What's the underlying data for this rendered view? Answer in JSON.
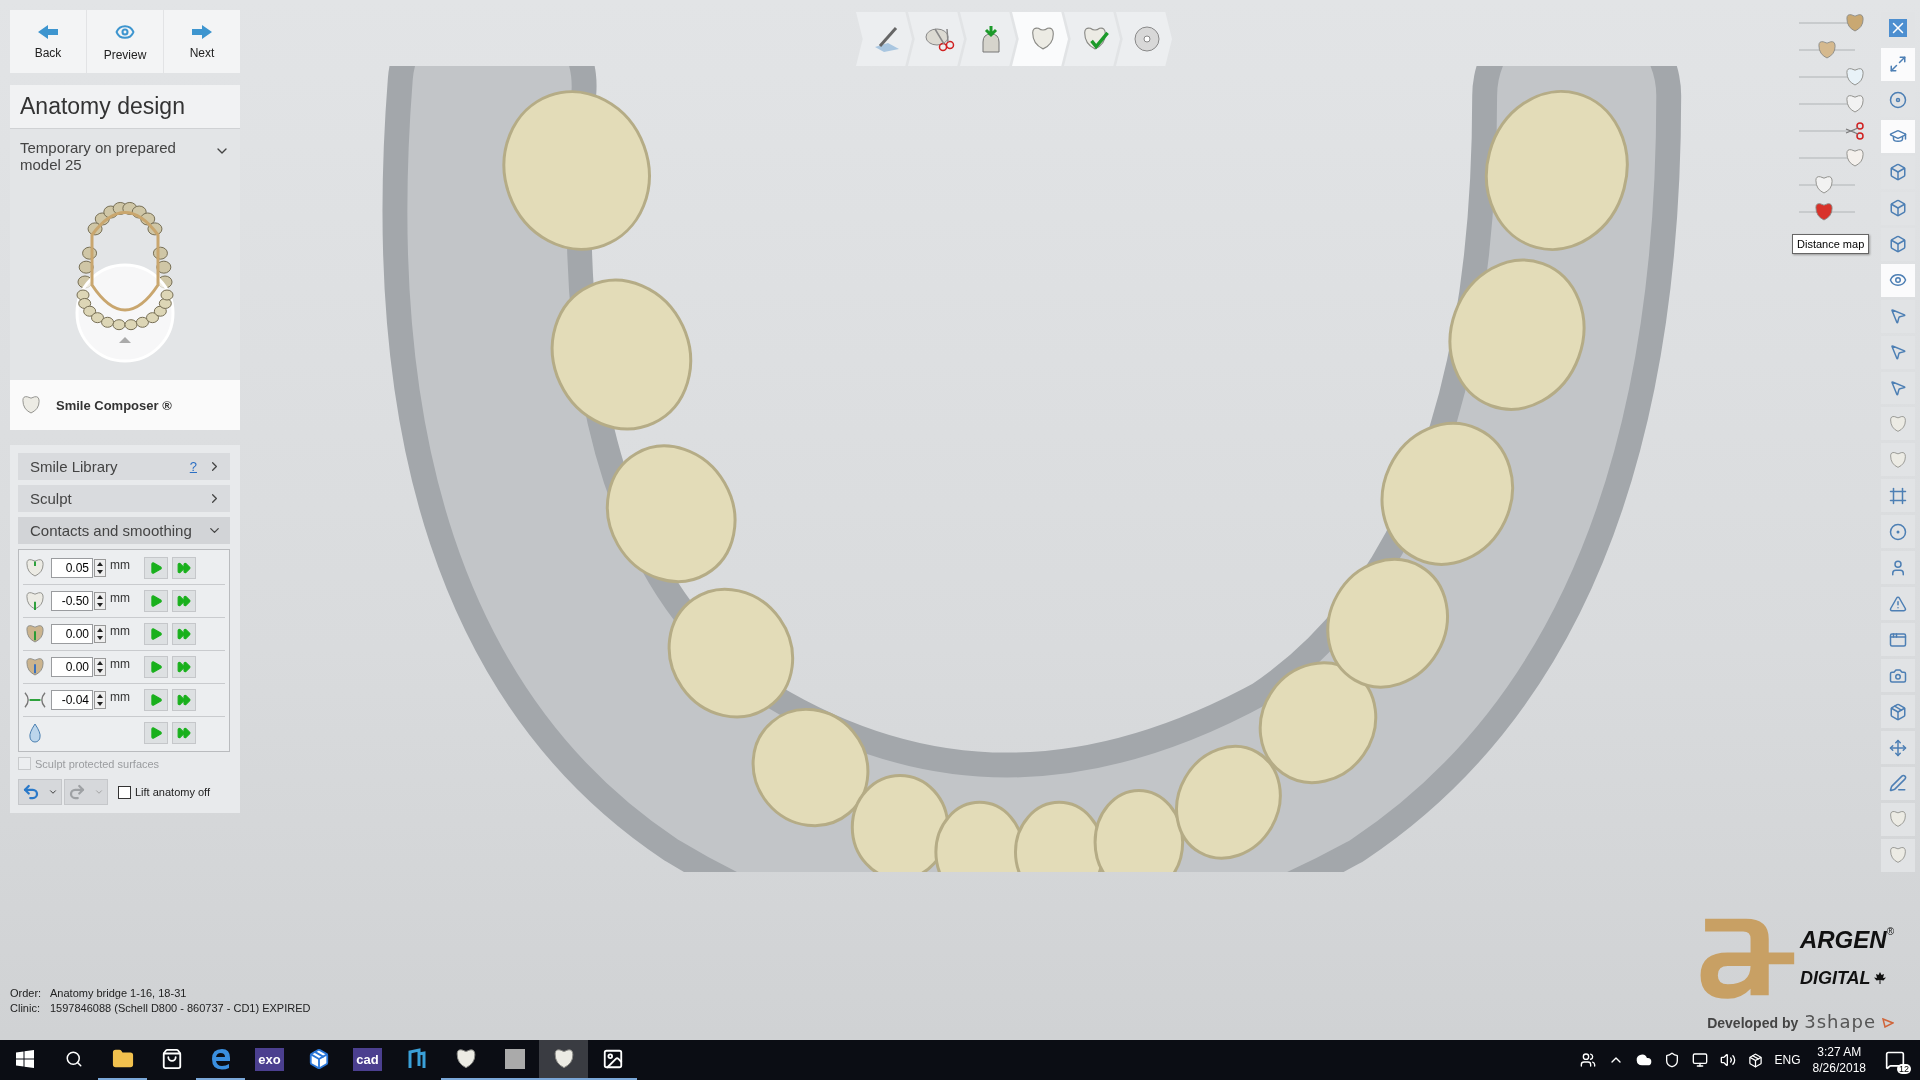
{
  "nav": [
    {
      "kind": "back",
      "label": "Back"
    },
    {
      "kind": "preview",
      "label": "Preview"
    },
    {
      "kind": "next",
      "label": "Next"
    }
  ],
  "title": "Anatomy design",
  "mode_dropdown": {
    "value": "Temporary on prepared model 25"
  },
  "smile_composer": {
    "label": "Smile Composer ®"
  },
  "sections": [
    {
      "label": "Smile Library",
      "help": "?",
      "expanded": false
    },
    {
      "label": "Sculpt",
      "expanded": false
    },
    {
      "label": "Contacts and smoothing",
      "expanded": true
    }
  ],
  "parameters": [
    {
      "kind": "occlusal",
      "value": "0.05",
      "unit": "mm"
    },
    {
      "kind": "antagonist",
      "value": "-0.50",
      "unit": "mm"
    },
    {
      "kind": "crown-up",
      "value": "0.00",
      "unit": "mm"
    },
    {
      "kind": "crown-down",
      "value": "0.00",
      "unit": "mm"
    },
    {
      "kind": "contact",
      "value": "-0.04",
      "unit": "mm"
    },
    {
      "kind": "smooth"
    }
  ],
  "sculpt_protected": {
    "label": "Sculpt protected surfaces",
    "checked": false,
    "disabled": true
  },
  "undo": {
    "disabled": false
  },
  "redo": {
    "disabled": true
  },
  "lift_anatomy": {
    "label": "Lift anatomy off",
    "checked": false
  },
  "workflow_steps": [
    {
      "kind": "scan",
      "selected": false
    },
    {
      "kind": "trim",
      "selected": false
    },
    {
      "kind": "insertion",
      "selected": false
    },
    {
      "kind": "anatomy",
      "selected": true
    },
    {
      "kind": "check",
      "selected": false
    },
    {
      "kind": "save",
      "selected": false
    }
  ],
  "view_sliders": [
    {
      "kind": "gold",
      "level": 1
    },
    {
      "kind": "stump",
      "level": 0.5
    },
    {
      "kind": "blue",
      "level": 1
    },
    {
      "kind": "white",
      "level": 1
    },
    {
      "kind": "scissors",
      "level": 1
    },
    {
      "kind": "red-rim",
      "level": 1
    },
    {
      "kind": "white",
      "level": 0.45
    },
    {
      "kind": "red",
      "level": 0.45
    }
  ],
  "tooltip": "Distance map",
  "side_tools": [
    {
      "kind": "close",
      "selected": false
    },
    {
      "kind": "fullscreen",
      "selected": true
    },
    {
      "kind": "disc",
      "selected": false
    },
    {
      "kind": "cap",
      "selected": true
    },
    {
      "kind": "cube",
      "selected": false
    },
    {
      "kind": "cube",
      "selected": false
    },
    {
      "kind": "cube",
      "selected": false
    },
    {
      "kind": "eye",
      "selected": true
    },
    {
      "kind": "pointer",
      "selected": false
    },
    {
      "kind": "pointer",
      "selected": false
    },
    {
      "kind": "pointer",
      "selected": false
    },
    {
      "kind": "tooth",
      "selected": false
    },
    {
      "kind": "tooth",
      "selected": false
    },
    {
      "kind": "frame",
      "selected": false
    },
    {
      "kind": "tape",
      "selected": false
    },
    {
      "kind": "person",
      "selected": false
    },
    {
      "kind": "warning",
      "selected": false
    },
    {
      "kind": "window",
      "selected": false
    },
    {
      "kind": "camera",
      "selected": false
    },
    {
      "kind": "box",
      "selected": false
    },
    {
      "kind": "axes",
      "selected": false
    },
    {
      "kind": "pen",
      "selected": false
    },
    {
      "kind": "tooth",
      "selected": false
    },
    {
      "kind": "tooth",
      "selected": false
    }
  ],
  "order": {
    "label": "Order:",
    "value": "Anatomy bridge 1-16, 18-31"
  },
  "clinic": {
    "label": "Clinic:",
    "value": "1597846088 (Schell D800 - 860737 - CD1) EXPIRED"
  },
  "logo": {
    "brand": "ARGEN",
    "registered": "®",
    "sub": "DIGITAL",
    "developed": "Developed by",
    "maker": "3shape"
  },
  "taskbar": {
    "apps": [
      {
        "kind": "folder",
        "running": true,
        "selected": false
      },
      {
        "kind": "store",
        "running": false,
        "selected": false
      },
      {
        "kind": "edge",
        "running": true,
        "selected": false
      },
      {
        "kind": "text",
        "label": "exo",
        "running": false,
        "selected": false
      },
      {
        "kind": "dropbox",
        "running": false,
        "selected": false
      },
      {
        "kind": "text",
        "label": "cad",
        "running": false,
        "selected": false
      },
      {
        "kind": "n",
        "running": false,
        "selected": false
      },
      {
        "kind": "tooth",
        "running": true,
        "selected": false
      },
      {
        "kind": "gray",
        "running": true,
        "selected": false
      },
      {
        "kind": "tooth",
        "running": true,
        "selected": true
      },
      {
        "kind": "photo",
        "running": true,
        "selected": false
      }
    ],
    "language": "ENG",
    "time": "3:27 AM",
    "date": "8/26/2018",
    "notifications": "12"
  }
}
